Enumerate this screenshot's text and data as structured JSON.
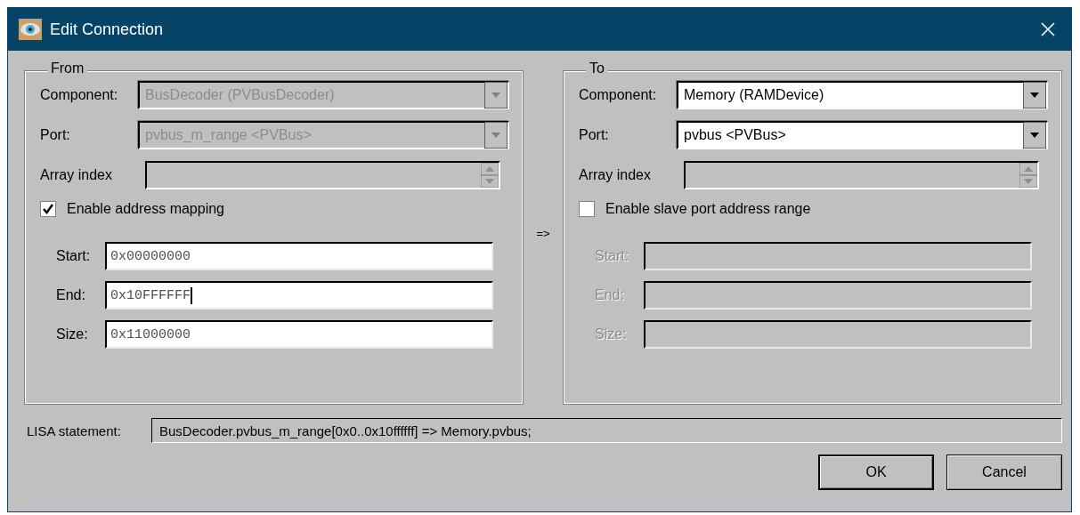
{
  "window": {
    "title": "Edit Connection"
  },
  "groups": [
    {
      "title": "From",
      "component": {
        "label": "Component:",
        "value": "BusDecoder (PVBusDecoder)",
        "disabled": true
      },
      "port": {
        "label": "Port:",
        "value": "pvbus_m_range <PVBus>",
        "disabled": true
      },
      "array_index": {
        "label": "Array index",
        "disabled": true
      },
      "option": {
        "label": "Enable address mapping",
        "checked": true
      },
      "fields": [
        {
          "label": "Start:",
          "value": "0x00000000",
          "disabled": false,
          "focused": false
        },
        {
          "label": "End:",
          "value": "0x10FFFFFF",
          "disabled": false,
          "focused": true
        },
        {
          "label": "Size:",
          "value": "0x11000000",
          "disabled": false,
          "focused": false
        }
      ]
    },
    {
      "title": "To",
      "component": {
        "label": "Component:",
        "value": "Memory (RAMDevice)",
        "disabled": false
      },
      "port": {
        "label": "Port:",
        "value": "pvbus <PVBus>",
        "disabled": false
      },
      "array_index": {
        "label": "Array index",
        "disabled": true
      },
      "option": {
        "label": "Enable slave port address range",
        "checked": false
      },
      "fields": [
        {
          "label": "Start:",
          "disabled": true,
          "focused": false
        },
        {
          "label": "End:",
          "disabled": true,
          "focused": false
        },
        {
          "label": "Size:",
          "disabled": true,
          "focused": false
        }
      ]
    }
  ],
  "arrow": "=>",
  "lisa": {
    "label": "LISA statement:",
    "value": "BusDecoder.pvbus_m_range[0x0..0x10ffffff] => Memory.pvbus;"
  },
  "buttons": [
    {
      "label": "OK",
      "default": true
    },
    {
      "label": "Cancel",
      "default": false
    }
  ]
}
